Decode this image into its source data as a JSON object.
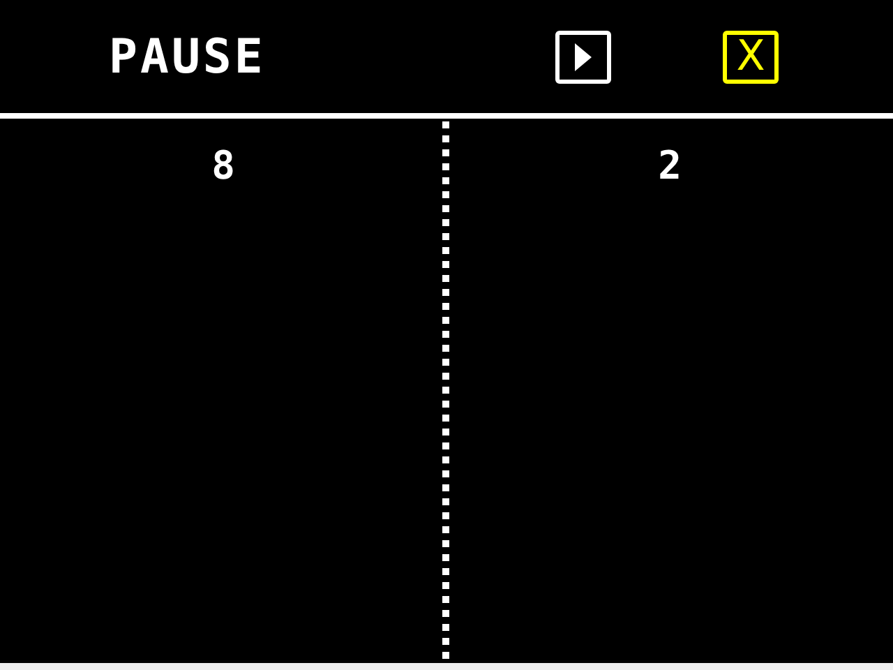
{
  "title": "PAUSE",
  "buttons": [
    {
      "kind": "play",
      "selected": false
    },
    {
      "kind": "close",
      "label": "X",
      "selected": true
    }
  ],
  "scores": [
    "8",
    "2"
  ]
}
